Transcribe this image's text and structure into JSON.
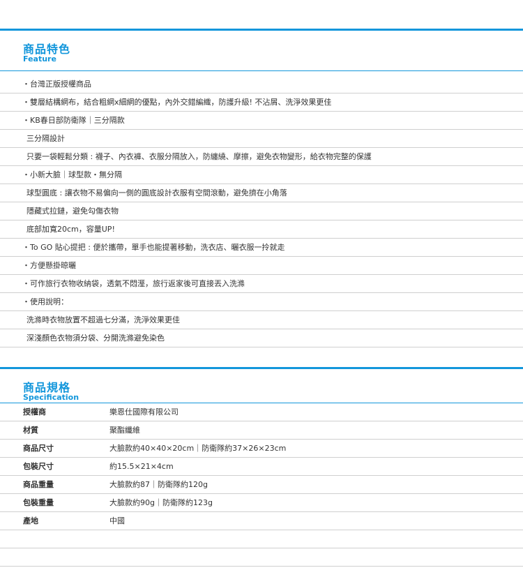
{
  "colors": {
    "accent": "#1296db",
    "row_border": "#cfcfcf",
    "text": "#333333"
  },
  "feature": {
    "title": "商品特色",
    "subtitle": "Feature",
    "items": [
      {
        "text": "・台灣正版授權商品"
      },
      {
        "text": "・雙層結構網布，結合粗網x細網的優點，內外交錯編織，防護升級! 不沾屑、洗淨效果更佳"
      },
      {
        "text": "・KB春日部防衛隊｜三分隔款"
      },
      {
        "text": "三分隔設計"
      },
      {
        "text": "只要一袋輕鬆分類 : 襪子、內衣褲、衣服分隔放入，防纏繞、摩擦，避免衣物變形，給衣物完整的保護"
      },
      {
        "text": "・小新大臉｜球型款・無分隔"
      },
      {
        "text": "球型圓底 : 讓衣物不易偏向一側的圓底設計衣服有空間滾動，避免擠在小角落"
      },
      {
        "text": "隱藏式拉鏈，避免勾傷衣物"
      },
      {
        "text": "底部加寬20cm，容量UP!"
      },
      {
        "text": "・To GO 貼心提把 : 便於攜帶，單手也能提著移動，洗衣店、曬衣服一拎就走"
      },
      {
        "text": "・方便懸掛晾曬"
      },
      {
        "text": "・可作旅行衣物收納袋，透氣不悶溼，旅行返家後可直接丟入洗滌"
      },
      {
        "text": "・使用說明："
      },
      {
        "text": "洗滌時衣物放置不超過七分滿，洗淨效果更佳"
      },
      {
        "text": "深淺顏色衣物須分袋、分開洗滌避免染色"
      }
    ]
  },
  "spec": {
    "title": "商品規格",
    "subtitle": "Specification",
    "rows": [
      {
        "label": "授權商",
        "value": "樂恩仕國際有限公司"
      },
      {
        "label": "材質",
        "value": "聚酯纖維"
      },
      {
        "label": "商品尺寸",
        "value": "大臉款約40×40×20cm｜防衛隊約37×26×23cm"
      },
      {
        "label": "包裝尺寸",
        "value": "約15.5×21×4cm"
      },
      {
        "label": "商品重量",
        "value": "大臉款約87｜防衛隊約120g"
      },
      {
        "label": "包裝重量",
        "value": "大臉款約90g｜防衛隊約123g"
      },
      {
        "label": "產地",
        "value": "中國"
      },
      {
        "label": "",
        "value": ""
      },
      {
        "label": "",
        "value": ""
      }
    ]
  }
}
